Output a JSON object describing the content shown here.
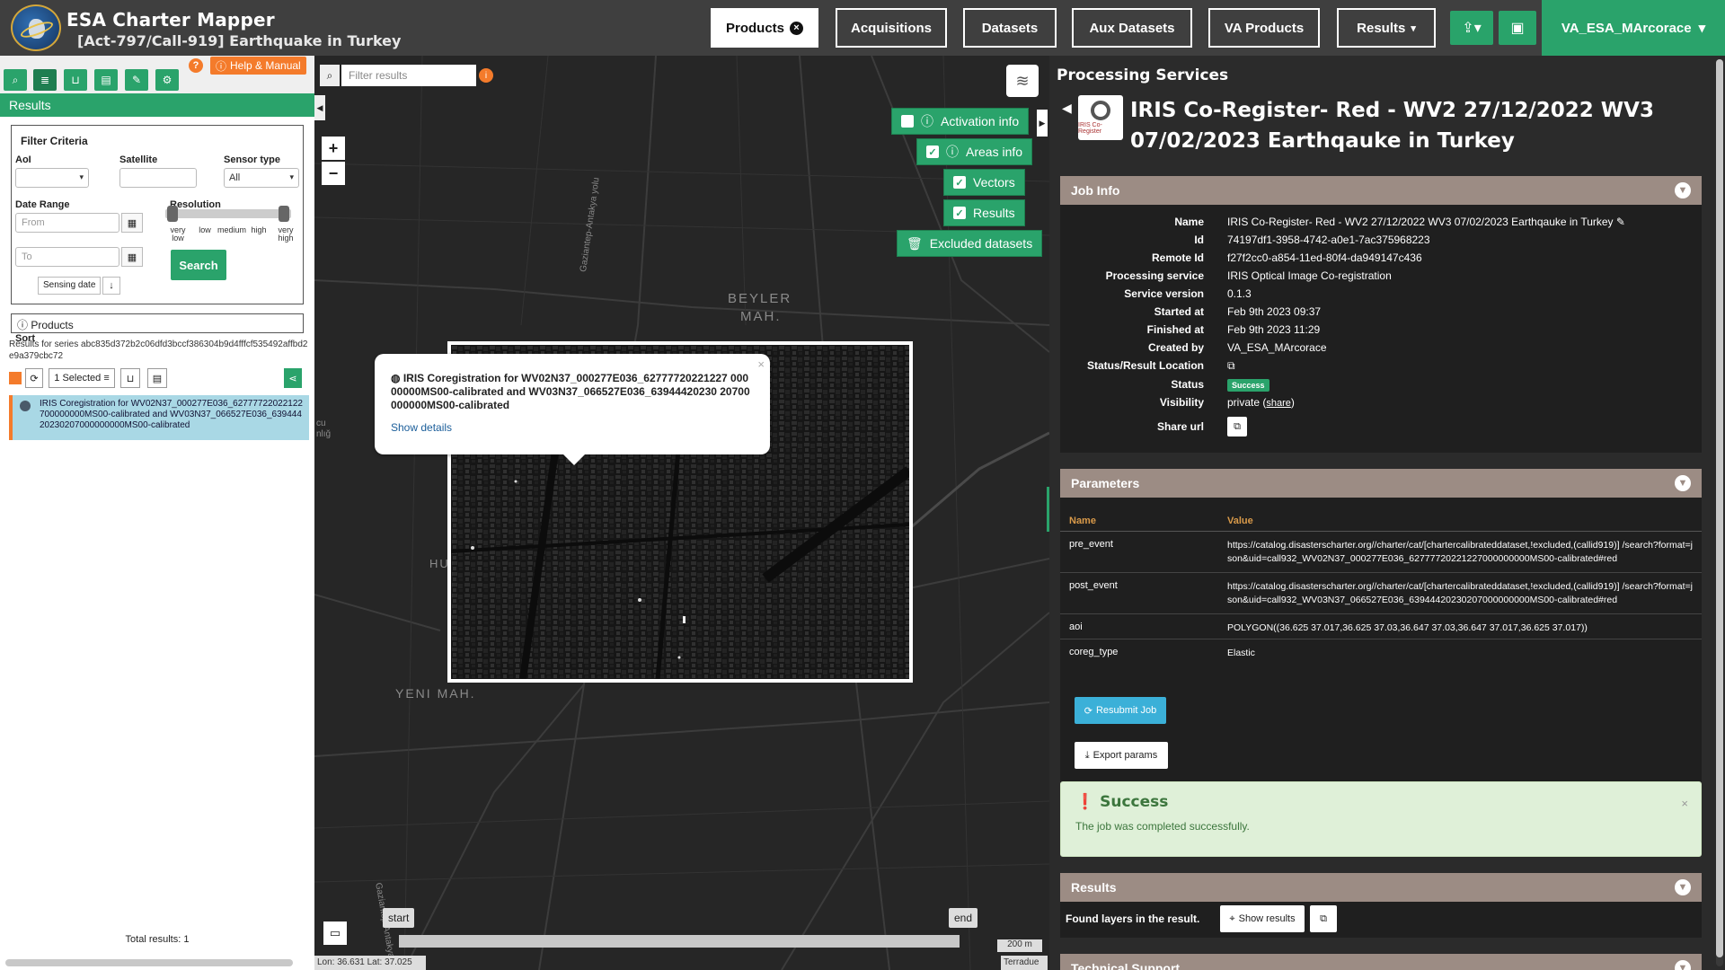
{
  "header": {
    "app_title": "ESA Charter Mapper",
    "activation_title": "[Act-797/Call-919] Earthquake in Turkey",
    "nav": [
      {
        "label": "Products",
        "active": true
      },
      {
        "label": "Acquisitions"
      },
      {
        "label": "Datasets"
      },
      {
        "label": "Aux Datasets"
      },
      {
        "label": "VA Products"
      },
      {
        "label": "Results"
      }
    ],
    "user": "VA_ESA_MArcorace",
    "colors": {
      "bar": "#3f3f3f",
      "accent": "#2aa36b",
      "warning": "#f47b2b"
    }
  },
  "left": {
    "help_label": "Help & Manual",
    "results_header": "Results",
    "filter": {
      "title": "Filter Criteria",
      "aoi_label": "AoI",
      "satellite_label": "Satellite",
      "sensor_label": "Sensor type",
      "sensor_value": "All",
      "date_label": "Date Range",
      "from_placeholder": "From",
      "to_placeholder": "To",
      "resolution_label": "Resolution",
      "resolution_levels": [
        "very low",
        "low",
        "medium",
        "high",
        "very high"
      ],
      "search_label": "Search",
      "sort_label": "Sort",
      "sort_value": "Sensing date"
    },
    "products_label": "Products",
    "series_label": "Results for series abc835d372b2c06dfd3bccf386304b9d4fffcf535492affbd2e9a379cbc72",
    "selected_label": "1 Selected",
    "result_item": "IRIS Coregistration for WV02N37_000277E036_62777722022122700000000MS00-calibrated and WV03N37_066527E036_63944420230207000000000MS00-calibrated",
    "total": "Total results: 1"
  },
  "map": {
    "filter_placeholder": "Filter results",
    "toggles": [
      {
        "label": "Activation info",
        "checked": false
      },
      {
        "label": "Areas info",
        "checked": true
      },
      {
        "label": "Vectors",
        "checked": true
      },
      {
        "label": "Results",
        "checked": true
      },
      {
        "label": "Excluded datasets"
      }
    ],
    "labels": {
      "beyler": "BEYLER",
      "mah": "MAH.",
      "yeni": "YENI MAH.",
      "road1": "Gaziantep-Antakya yolu",
      "road2": "Gaziantep-Antakya",
      "hu": "HU",
      "cu": "cu",
      "nlig": "nlığ"
    },
    "popup": {
      "title": "IRIS Coregistration for WV02N37_000277E036_62777720221227 00000000MS00-calibrated and WV03N37_066527E036_63944420230 20700000000MS00-calibrated",
      "link": "Show details"
    },
    "timeline": {
      "start": "start",
      "end": "end"
    },
    "scale": "200 m",
    "coords": "Lon: 36.631 Lat: 37.025",
    "attribution": "Terradue"
  },
  "right": {
    "title": "Processing Services",
    "service_icon_text": "IRIS Co-Register",
    "job_title": "IRIS Co-Register- Red - WV2 27/12/2022 WV3 07/02/2023 Earthqauke in Turkey",
    "job_info": {
      "header": "Job Info",
      "rows": [
        {
          "k": "Name",
          "v": "IRIS Co-Register- Red - WV2 27/12/2022 WV3 07/02/2023 Earthqauke in Turkey"
        },
        {
          "k": "Id",
          "v": "74197df1-3958-4742-a0e1-7ac375968223"
        },
        {
          "k": "Remote Id",
          "v": "f27f2cc0-a854-11ed-80f4-da949147c436"
        },
        {
          "k": "Processing service",
          "v": "IRIS Optical Image Co-registration"
        },
        {
          "k": "Service version",
          "v": "0.1.3"
        },
        {
          "k": "Started at",
          "v": "Feb 9th 2023 09:37"
        },
        {
          "k": "Finished at",
          "v": "Feb 9th 2023 11:29"
        },
        {
          "k": "Created by",
          "v": "VA_ESA_MArcorace"
        },
        {
          "k": "Status/Result Location",
          "v": ""
        },
        {
          "k": "Status",
          "v": "Success"
        },
        {
          "k": "Visibility",
          "v": "private"
        },
        {
          "k": "Share url",
          "v": ""
        }
      ],
      "share_link": "share"
    },
    "parameters": {
      "header": "Parameters",
      "col_name": "Name",
      "col_value": "Value",
      "rows": [
        {
          "name": "pre_event",
          "value": "https://catalog.disasterscharter.org//charter/cat/[chartercalibrateddataset,!excluded,(callid919)] /search?format=json&uid=call932_WV02N37_000277E036_62777720221227000000000MS00-calibrated#red"
        },
        {
          "name": "post_event",
          "value": "https://catalog.disasterscharter.org//charter/cat/[chartercalibrateddataset,!excluded,(callid919)] /search?format=json&uid=call932_WV03N37_066527E036_63944420230207000000000MS00-calibrated#red"
        },
        {
          "name": "aoi",
          "value": "POLYGON((36.625 37.017,36.625 37.03,36.647 37.03,36.647 37.017,36.625 37.017))"
        },
        {
          "name": "coreg_type",
          "value": "Elastic"
        }
      ],
      "resubmit": "Resubmit Job",
      "export": "Export params"
    },
    "success": {
      "title": "Success",
      "message": "The job was completed successfully."
    },
    "results": {
      "header": "Results",
      "found": "Found layers in the result.",
      "show": "Show results"
    },
    "technical_header": "Technical Support"
  }
}
